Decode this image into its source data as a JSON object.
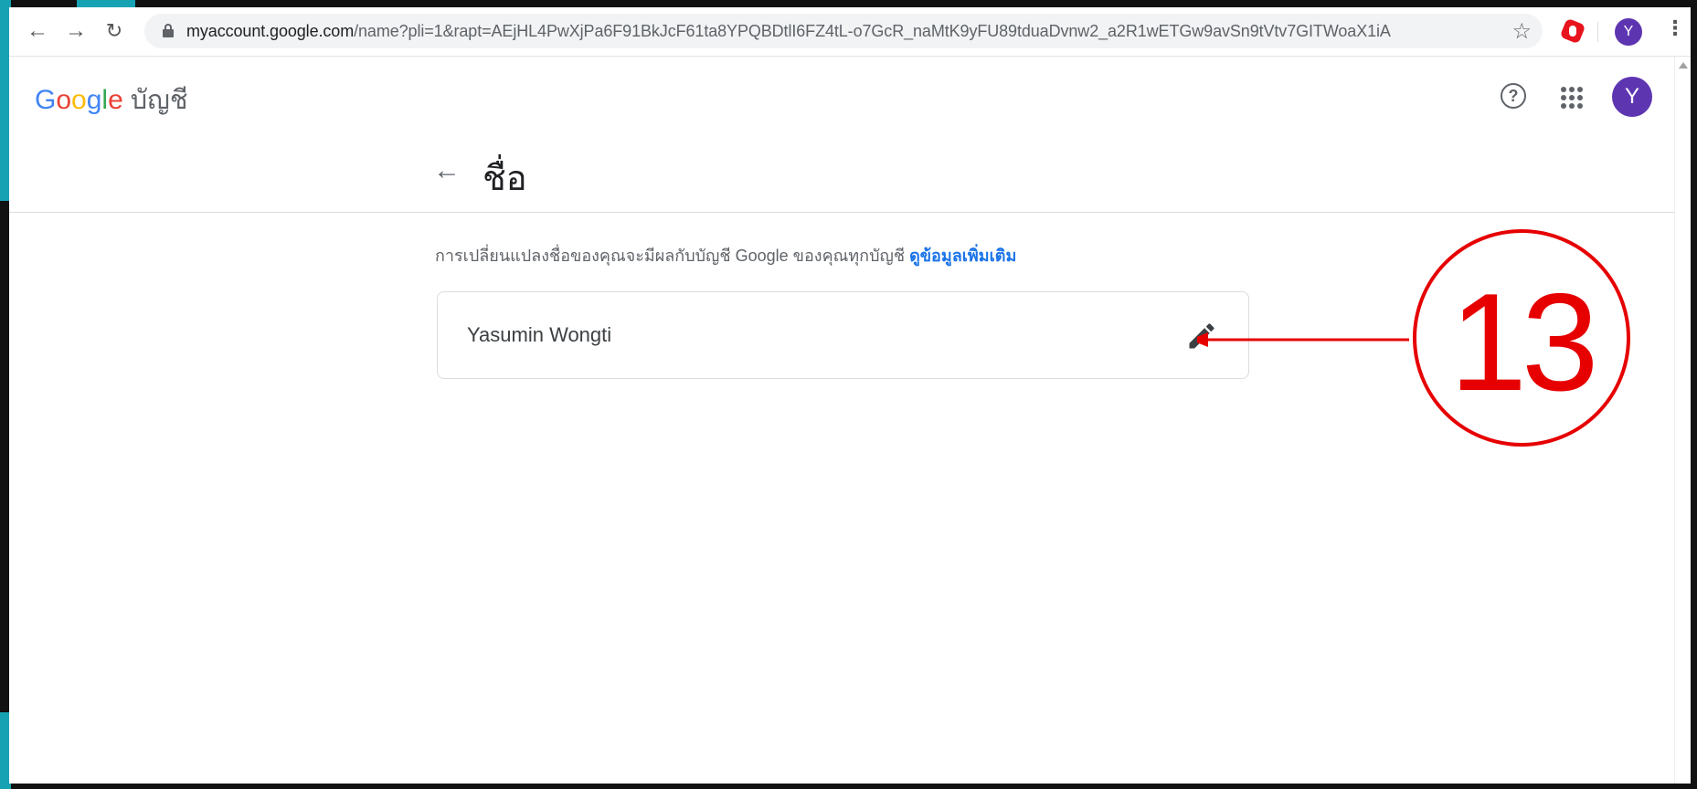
{
  "browser": {
    "url_host": "myaccount.google.com",
    "url_rest": "/name?pli=1&rapt=AEjHL4PwXjPa6F91BkJcF61ta8YPQBDtlI6FZ4tL-o7GcR_naMtK9yFU89tduaDvnw2_a2R1wETGw9avSn9tVtv7GITWoaX1iA",
    "profile_initial": "Y",
    "icons": {
      "back": "arrow-left-icon",
      "forward": "arrow-right-icon",
      "reload": "reload-icon",
      "bookmark": "star-icon",
      "extension": "opera-adblock-icon",
      "menu": "kebab-menu-icon"
    }
  },
  "header": {
    "logo": {
      "g": "G",
      "o1": "o",
      "o2": "o",
      "g2": "g",
      "l": "l",
      "e": "e",
      "suffix": "บัญชี"
    },
    "help_glyph": "?",
    "avatar_initial": "Y",
    "accent_color": "#5e35b1"
  },
  "page": {
    "title": "ชื่อ",
    "description": "การเปลี่ยนแปลงชื่อของคุณจะมีผลกับบัญชี Google ของคุณทุกบัญชี",
    "learn_more": "ดูข้อมูลเพิ่มเติม"
  },
  "name_card": {
    "value": "Yasumin Wongti",
    "edit_icon": "pencil-icon"
  },
  "annotation": {
    "step_number": "13",
    "color": "#e60000"
  }
}
